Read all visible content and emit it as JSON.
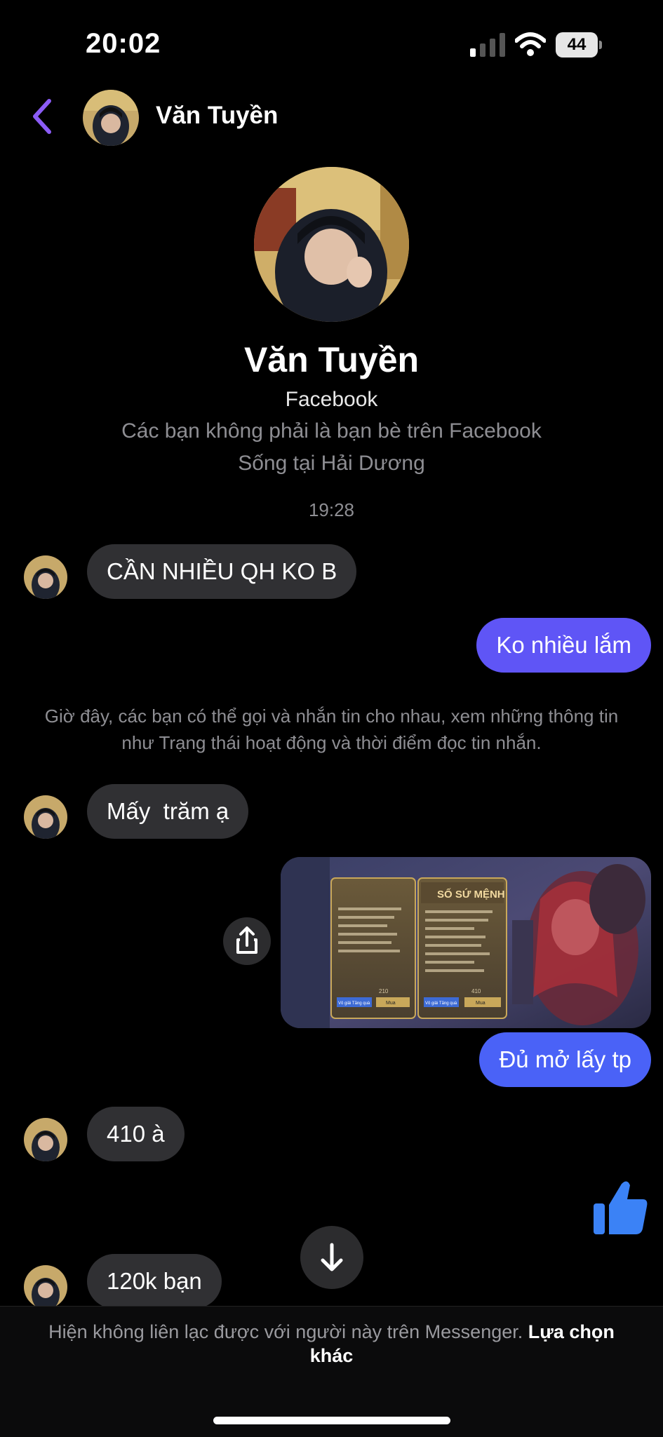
{
  "status_bar": {
    "time": "20:02",
    "battery": "44"
  },
  "header": {
    "name": "Văn Tuyền",
    "back_icon": "chevron-left-icon",
    "accent": "#7b4dff"
  },
  "profile": {
    "name": "Văn Tuyền",
    "platform": "Facebook",
    "relationship": "Các bạn không phải là bạn bè trên Facebook",
    "location": "Sống tại Hải Dương"
  },
  "timestamp": "19:28",
  "messages": [
    {
      "from": "them",
      "text": "CẦN NHIỀU QH KO B"
    },
    {
      "from": "me",
      "text": "Ko nhiều lắm"
    },
    {
      "from": "them",
      "text": "Mấy  trăm ạ"
    },
    {
      "from": "me",
      "type": "image"
    },
    {
      "from": "me",
      "text": "Đủ mở lấy tp"
    },
    {
      "from": "them",
      "text": "410 à"
    },
    {
      "from": "me",
      "type": "like"
    },
    {
      "from": "them",
      "text": "120k bạn"
    }
  ],
  "notice": "Giờ đây, các bạn có thể gọi và nhắn tin cho nhau, xem những thông tin như Trạng thái hoạt động và thời điểm đọc tin nhắn.",
  "attachment": {
    "left_panel_title": "",
    "right_panel_title": "SỐ SỨ MỆNH",
    "left_button": "Vô giải Tăng quà",
    "right_button": "Mua",
    "left_count": "210",
    "right_count": "410"
  },
  "footer": {
    "text": "Hiện không liên lạc được với người này trên Messenger.",
    "link": "Lựa chọn khác"
  },
  "colors": {
    "outgoing": "#5f55f6",
    "outgoing_alt": "#4a62f7",
    "incoming": "#303033",
    "like": "#3b82f6"
  }
}
